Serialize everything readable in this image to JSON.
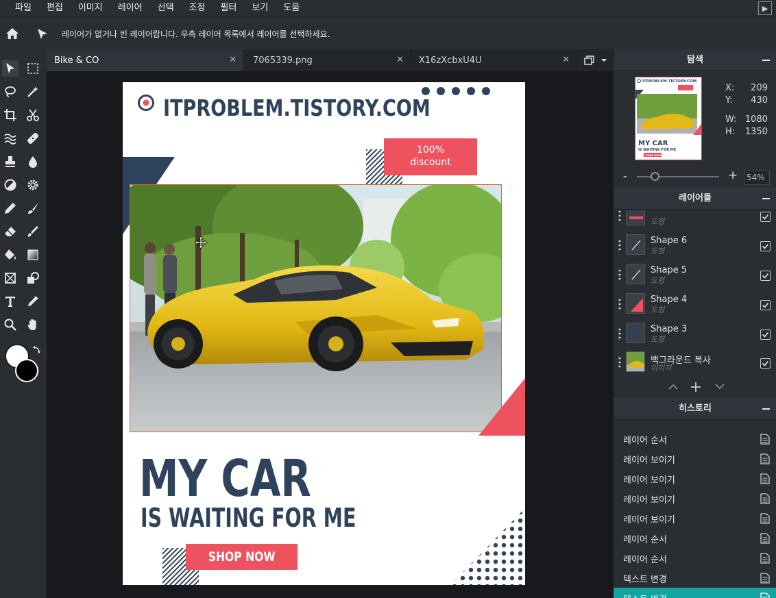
{
  "menubar": {
    "items": [
      "파일",
      "편집",
      "이미지",
      "레이어",
      "선택",
      "조정",
      "필터",
      "보기",
      "도움"
    ]
  },
  "options": {
    "message": "레이어가 없거나 빈 레이어랍니다. 우측 레이어 목록에서 레이어를 선택하세요."
  },
  "tabs": [
    {
      "label": "Bike & CO",
      "active": true
    },
    {
      "label": "7065339.png",
      "active": false
    },
    {
      "label": "X16zXcbxU4U",
      "active": false
    }
  ],
  "document": {
    "site_title": "ITPROBLEM.TISTORY.COM",
    "badge_line1": "100%",
    "badge_line2": "discount",
    "headline1": "MY CAR",
    "headline2": "IS WAITING FOR ME",
    "button": "SHOP NOW",
    "thumb_title": "ITPROBLEM.TISTORY.COM",
    "thumb_h1": "MY CAR",
    "thumb_h2": "IS WAITING FOR ME",
    "thumb_btn": "SHOP NOW",
    "colors": {
      "navy": "#2e435b",
      "red": "#ee525e",
      "car_yellow": "#e8c21c"
    }
  },
  "navigator": {
    "title": "탐색",
    "x_label": "X:",
    "x": "209",
    "y_label": "Y:",
    "y": "430",
    "w_label": "W:",
    "w": "1080",
    "h_label": "H:",
    "h": "1350",
    "zoom_minus": "-",
    "zoom_plus": "+",
    "zoom": "54%"
  },
  "layers": {
    "title": "레이어들",
    "items": [
      {
        "name": "",
        "type": "도형"
      },
      {
        "name": "Shape 6",
        "type": "도형"
      },
      {
        "name": "Shape 5",
        "type": "도형"
      },
      {
        "name": "Shape 4",
        "type": "도형"
      },
      {
        "name": "Shape 3",
        "type": "도형"
      },
      {
        "name": "백그라운드 복사",
        "type": "이미지"
      }
    ]
  },
  "history": {
    "title": "히스토리",
    "items": [
      "레이어 순서",
      "레이어 보이기",
      "레이어 보이기",
      "레이어 보이기",
      "레이어 보이기",
      "레이어 순서",
      "레이어 순서",
      "텍스트 변경",
      "텍스트 변경"
    ]
  },
  "icons": {
    "home": "home-icon",
    "move": "move-tool-icon",
    "marquee": "marquee-icon",
    "lasso": "lasso-icon",
    "wand": "magic-wand-icon",
    "crop": "crop-icon",
    "scissors": "scissors-icon"
  }
}
